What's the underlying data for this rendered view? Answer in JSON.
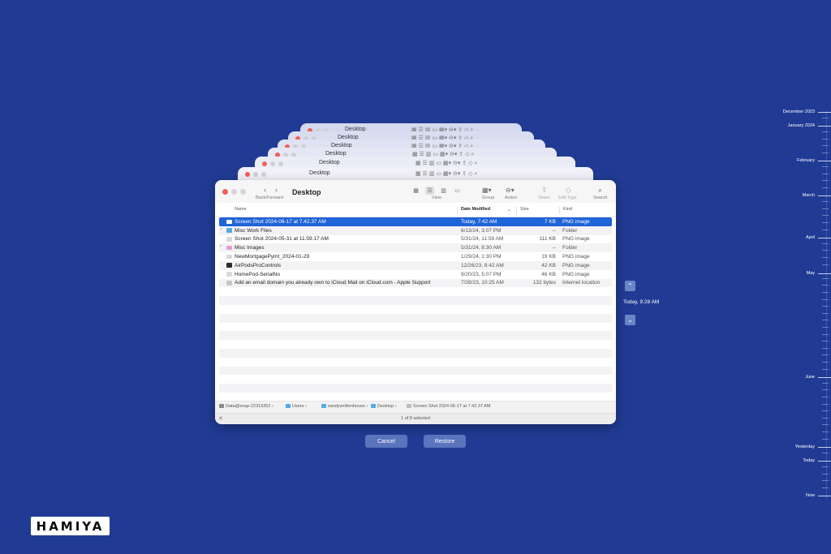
{
  "window": {
    "title": "Desktop",
    "backforward_label": "Back/Forward",
    "toolbar": {
      "view": "View",
      "group": "Group",
      "action": "Action",
      "share": "Share",
      "edit_tags": "Edit Tags",
      "search": "Search"
    }
  },
  "stack_title": "Desktop",
  "columns": {
    "name": "Name",
    "date_modified": "Date Modified",
    "size": "Size",
    "kind": "Kind"
  },
  "files": [
    {
      "name": "Screen Shot 2024-06-17 at 7.42.37 AM",
      "date": "Today, 7:42 AM",
      "size": "7 KB",
      "kind": "PNG image",
      "icon": "image-file-icon",
      "selected": true
    },
    {
      "name": "Misc Work Files",
      "date": "6/13/24, 3:07 PM",
      "size": "--",
      "kind": "Folder",
      "icon": "folder-icon"
    },
    {
      "name": "Screen Shot 2024-05-31 at 11.59.17 AM",
      "date": "5/31/24, 11:59 AM",
      "size": "111 KB",
      "kind": "PNG image",
      "icon": "image-file-icon"
    },
    {
      "name": "Misc Images",
      "date": "5/31/24, 8:30 AM",
      "size": "--",
      "kind": "Folder",
      "icon": "pink-folder-icon"
    },
    {
      "name": "NewMortgagePymt_2024-01-29",
      "date": "1/29/24, 1:30 PM",
      "size": "19 KB",
      "kind": "PNG image",
      "icon": "image-file-icon"
    },
    {
      "name": "AirPodsProControls",
      "date": "12/26/23, 8:42 AM",
      "size": "42 KB",
      "kind": "PNG image",
      "icon": "dark-image-file-icon"
    },
    {
      "name": "HomePod-SerialNo",
      "date": "9/20/23, 5:07 PM",
      "size": "46 KB",
      "kind": "PNG image",
      "icon": "image-file-icon"
    },
    {
      "name": "Add an email domain you already own to iCloud Mail on iCloud.com - Apple Support",
      "date": "7/28/23, 10:25 AM",
      "size": "132 bytes",
      "kind": "Internet location",
      "icon": "internet-location-icon"
    }
  ],
  "path_bar": [
    "Data@snap-22316352",
    "Users",
    "sandywrittenhouse",
    "Desktop",
    "Screen Shot 2024-06-17 at 7.42.37 AM"
  ],
  "status": "1 of 8 selected",
  "buttons": {
    "cancel": "Cancel",
    "restore": "Restore"
  },
  "time_machine": {
    "current": "Today, 9:28 AM"
  },
  "timeline": [
    "December 2023",
    "January 2024",
    "February",
    "March",
    "April",
    "May",
    "June",
    "Yesterday",
    "Today",
    "Now"
  ],
  "logo": "HAMIYA"
}
